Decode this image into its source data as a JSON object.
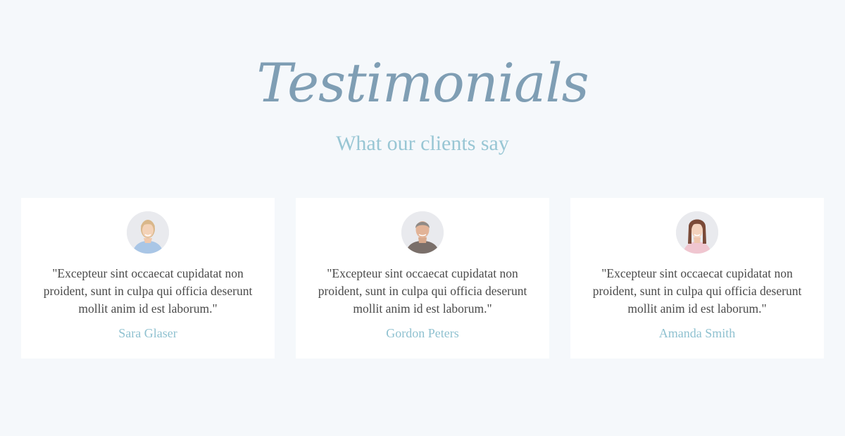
{
  "section": {
    "title": "Testimonials",
    "subtitle": "What our clients say"
  },
  "testimonials": [
    {
      "avatar_icon": "woman-blonde-avatar",
      "quote": "\"Excepteur sint occaecat cupidatat non proident, sunt in culpa qui officia deserunt mollit anim id est laborum.\"",
      "name": "Sara Glaser"
    },
    {
      "avatar_icon": "man-gray-hair-avatar",
      "quote": "\"Excepteur sint occaecat cupidatat non proident, sunt in culpa qui officia deserunt mollit anim id est laborum.\"",
      "name": "Gordon Peters"
    },
    {
      "avatar_icon": "woman-brunette-avatar",
      "quote": "\"Excepteur sint occaecat cupidatat non proident, sunt in culpa qui officia deserunt mollit anim id est laborum.\"",
      "name": "Amanda Smith"
    }
  ],
  "colors": {
    "background": "#f5f8fb",
    "title": "#7f9eb4",
    "subtitle": "#98c6d4",
    "card": "#ffffff",
    "quote_text": "#4a4a4a",
    "name_text": "#8fc1d0"
  }
}
